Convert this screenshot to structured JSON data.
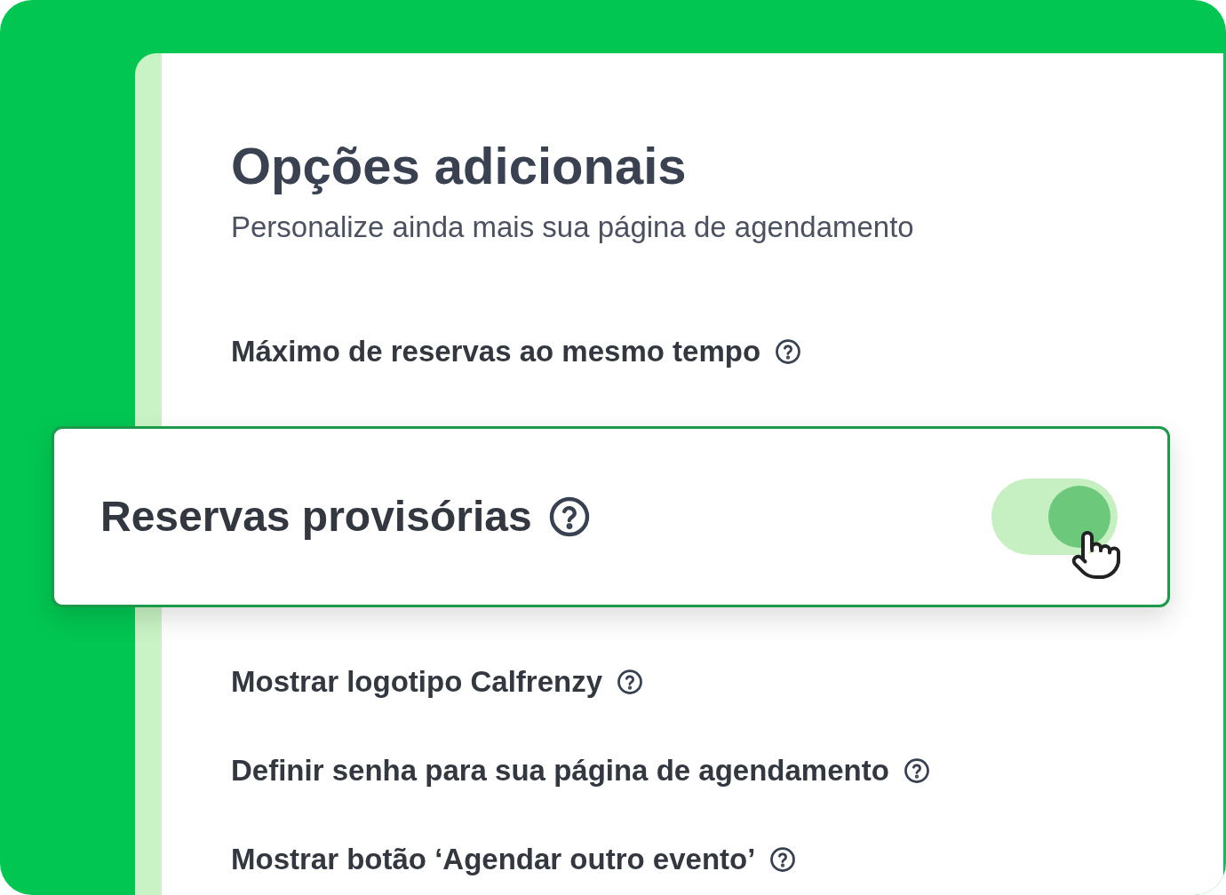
{
  "heading": "Opções adicionais",
  "subtitle": "Personalize ainda mais sua página de agendamento",
  "options": [
    {
      "kind": "row",
      "label": "Máximo de reservas ao mesmo tempo"
    },
    {
      "kind": "card",
      "label": "Reservas provisórias",
      "on": true
    },
    {
      "kind": "row",
      "label": "Mostrar logotipo Calfrenzy"
    },
    {
      "kind": "row",
      "label": "Definir senha para sua página de agendamento"
    },
    {
      "kind": "row",
      "label": "Mostrar botão ‘Agendar outro evento’"
    }
  ]
}
